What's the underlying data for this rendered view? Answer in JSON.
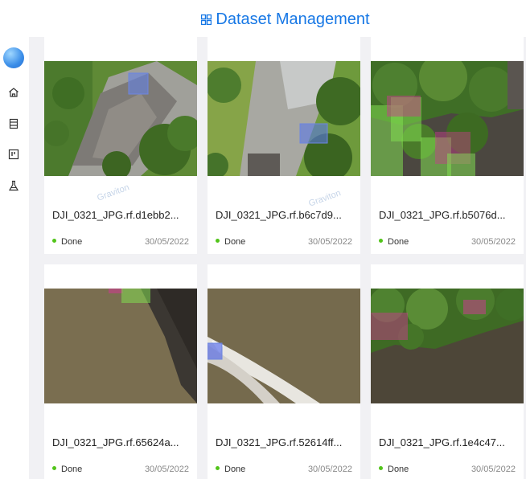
{
  "header": {
    "title": "Dataset Management",
    "icon": "grid-icon"
  },
  "sidebar": {
    "items": [
      {
        "name": "home",
        "icon": "home-icon"
      },
      {
        "name": "datasets",
        "icon": "dataset-icon"
      },
      {
        "name": "board",
        "icon": "board-icon"
      },
      {
        "name": "experiments",
        "icon": "flask-icon"
      }
    ]
  },
  "cards": [
    {
      "name": "DJI_0321_JPG.rf.d1ebb2...",
      "status": "Done",
      "date": "30/05/2022",
      "watermark": "Graviton"
    },
    {
      "name": "DJI_0321_JPG.rf.b6c7d9...",
      "status": "Done",
      "date": "30/05/2022",
      "watermark": "Graviton"
    },
    {
      "name": "DJI_0321_JPG.rf.b5076d...",
      "status": "Done",
      "date": "30/05/2022",
      "watermark": ""
    },
    {
      "name": "DJI_0321_JPG.rf.65624a...",
      "status": "Done",
      "date": "30/05/2022",
      "watermark": ""
    },
    {
      "name": "DJI_0321_JPG.rf.52614ff...",
      "status": "Done",
      "date": "30/05/2022",
      "watermark": ""
    },
    {
      "name": "DJI_0321_JPG.rf.1e4c47...",
      "status": "Done",
      "date": "30/05/2022",
      "watermark": ""
    }
  ],
  "colors": {
    "accent": "#1677e5",
    "done": "#52c41a",
    "background": "#f1f1f4"
  }
}
